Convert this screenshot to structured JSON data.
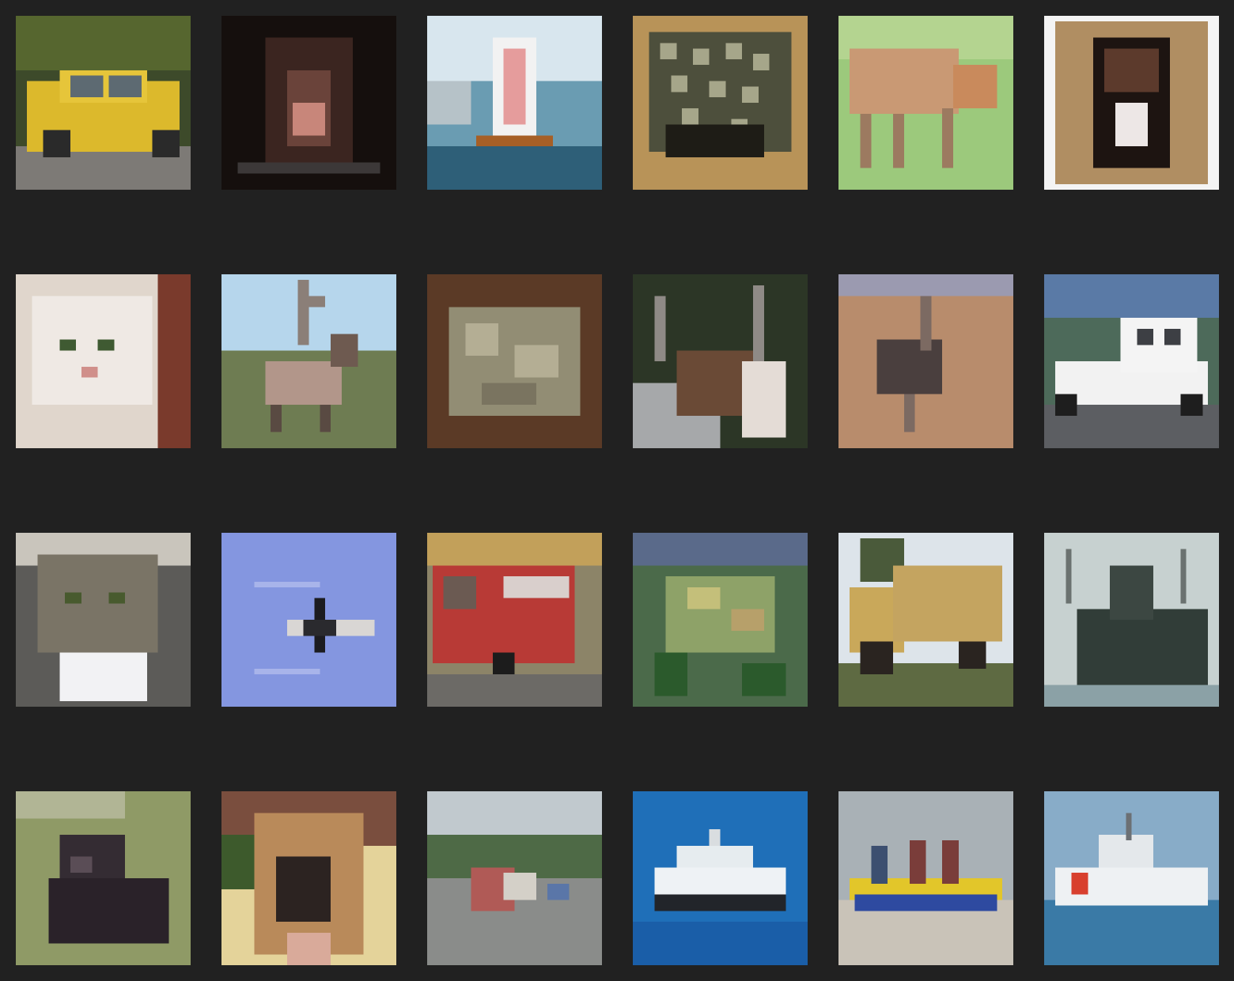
{
  "background": "#212121",
  "grid": {
    "rows": 4,
    "columns": 6
  },
  "tiles": [
    {
      "name": "image-yellow-car"
    },
    {
      "name": "image-dark-animal-face"
    },
    {
      "name": "image-sailboat"
    },
    {
      "name": "image-frog-spotted"
    },
    {
      "name": "image-deer-grass"
    },
    {
      "name": "image-cat-in-box"
    },
    {
      "name": "image-white-cat"
    },
    {
      "name": "image-reindeer"
    },
    {
      "name": "image-frog-brown"
    },
    {
      "name": "image-deer-antlers"
    },
    {
      "name": "image-ostrich"
    },
    {
      "name": "image-white-truck"
    },
    {
      "name": "image-tabby-cat"
    },
    {
      "name": "image-airplane-sky"
    },
    {
      "name": "image-fire-truck"
    },
    {
      "name": "image-frog-green"
    },
    {
      "name": "image-yellow-dump-truck"
    },
    {
      "name": "image-dark-ship"
    },
    {
      "name": "image-dark-dog"
    },
    {
      "name": "image-brown-dog"
    },
    {
      "name": "image-truck-on-road"
    },
    {
      "name": "image-cruise-ship"
    },
    {
      "name": "image-yellow-boat"
    },
    {
      "name": "image-coast-guard-ship"
    }
  ]
}
